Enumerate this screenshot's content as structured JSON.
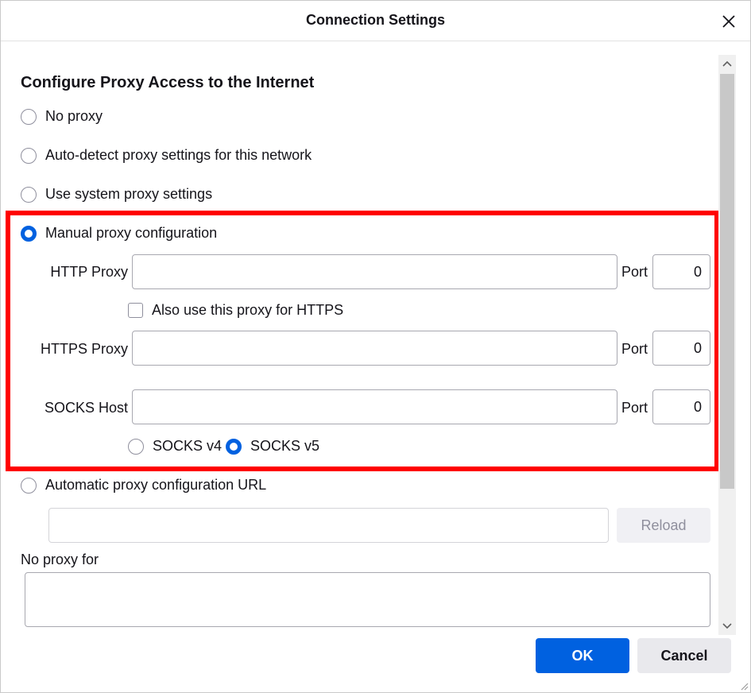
{
  "window": {
    "title": "Connection Settings"
  },
  "section": {
    "heading": "Configure Proxy Access to the Internet"
  },
  "proxy_options": {
    "no_proxy": "No proxy",
    "auto_detect": "Auto-detect proxy settings for this network",
    "system": "Use system proxy settings",
    "manual": "Manual proxy configuration",
    "auto_url": "Automatic proxy configuration URL",
    "selected": "manual"
  },
  "manual": {
    "http_label": "HTTP Proxy",
    "http_value": "",
    "http_port_label": "Port",
    "http_port": "0",
    "also_https_label": "Also use this proxy for HTTPS",
    "also_https_checked": false,
    "https_label": "HTTPS Proxy",
    "https_value": "",
    "https_port_label": "Port",
    "https_port": "0",
    "socks_label": "SOCKS Host",
    "socks_value": "",
    "socks_port_label": "Port",
    "socks_port": "0",
    "socks_v4": "SOCKS v4",
    "socks_v5": "SOCKS v5",
    "socks_version_selected": "v5"
  },
  "auto_url": {
    "value": "",
    "reload_label": "Reload"
  },
  "no_proxy_for": {
    "label": "No proxy for",
    "value": ""
  },
  "buttons": {
    "ok": "OK",
    "cancel": "Cancel"
  },
  "colors": {
    "accent": "#0061e0",
    "highlight": "#ff0000"
  }
}
